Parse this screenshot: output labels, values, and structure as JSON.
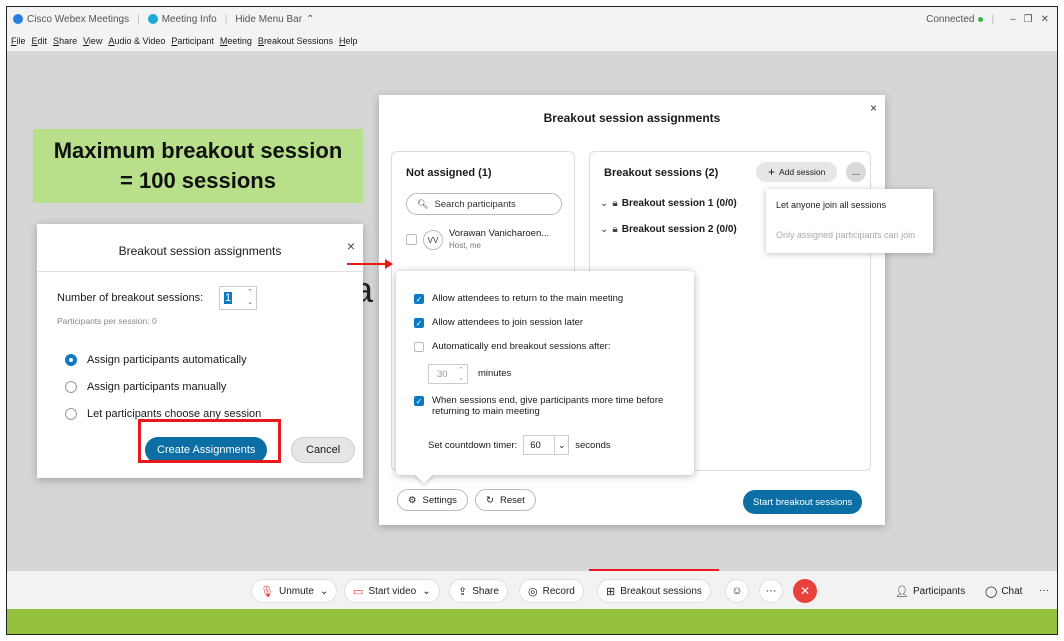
{
  "titlebar": {
    "app_name": "Cisco Webex Meetings",
    "meeting_info": "Meeting Info",
    "hide_menu": "Hide Menu Bar",
    "status": "Connected"
  },
  "menu": [
    "File",
    "Edit",
    "Share",
    "View",
    "Audio & Video",
    "Participant",
    "Meeting",
    "Breakout Sessions",
    "Help"
  ],
  "callout": {
    "line1": "Maximum breakout session",
    "line2": "= 100 sessions"
  },
  "main_dialog": {
    "title": "Breakout session assignments",
    "close": "×",
    "not_assigned_title": "Not assigned (1)",
    "search_placeholder": "Search participants",
    "participant_name": "Vorawan Vanicharoen...",
    "participant_initials": "VV",
    "participant_sub": "Host, me",
    "sessions_title": "Breakout sessions (2)",
    "add_session": "Add session",
    "more": "...",
    "sessions": [
      "Breakout session 1 (0/0)",
      "Breakout session 2 (0/0)"
    ],
    "settings": "Settings",
    "reset": "Reset",
    "start": "Start breakout sessions"
  },
  "dropdown": {
    "opt1": "Let anyone join all sessions",
    "opt2": "Only assigned participants can join"
  },
  "settings_popover": {
    "opt1": "Allow attendees to return to the main meeting",
    "opt2": "Allow attendees to join session later",
    "opt3": "Automatically end breakout sessions after:",
    "minutes_value": "30",
    "minutes_label": "minutes",
    "opt4_line1": "When sessions end, give participants more time before",
    "opt4_line2": "returning to main meeting",
    "timer_label": "Set countdown timer:",
    "timer_value": "60",
    "timer_unit": "seconds"
  },
  "small_dialog": {
    "title": "Breakout session assignments",
    "close": "×",
    "num_label": "Number of breakout sessions:",
    "num_value": "1",
    "per_session": "Participants per session: 0",
    "options": [
      "Assign participants automatically",
      "Assign participants manually",
      "Let participants choose any session"
    ],
    "create": "Create Assignments",
    "cancel": "Cancel"
  },
  "toolbar": {
    "unmute": "Unmute",
    "start_video": "Start video",
    "share": "Share",
    "record": "Record",
    "breakout": "Breakout sessions",
    "participants": "Participants",
    "chat": "Chat"
  },
  "colors": {
    "accent": "#0b6fa5",
    "highlight": "#e8191c",
    "callout_bg": "#b8e08a",
    "footer_green": "#94c13e",
    "end_red": "#e8403a"
  }
}
